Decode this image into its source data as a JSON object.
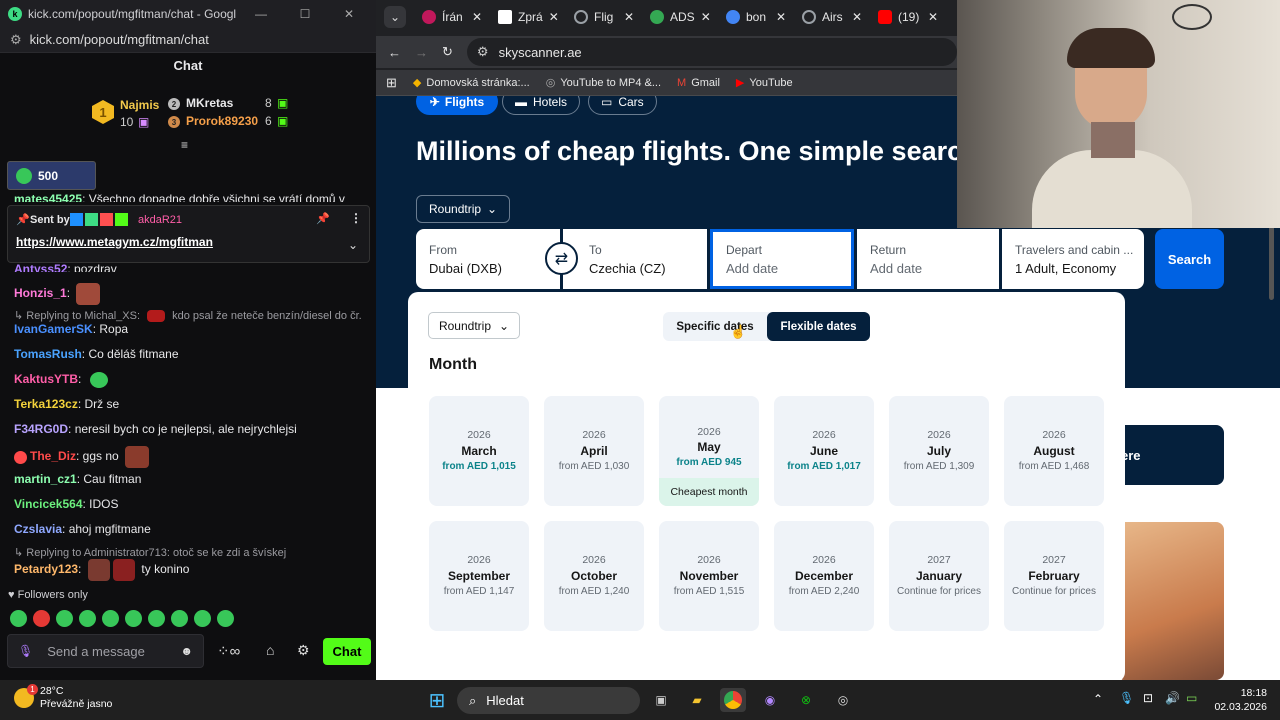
{
  "chat_window": {
    "title": "kick.com/popout/mgfitman/chat - Google Chrome",
    "url": "kick.com/popout/mgfitman/chat",
    "header": "Chat",
    "leaderboard": [
      {
        "name": "Najmis",
        "count": "10",
        "rank": "1"
      },
      {
        "name": "MKretas",
        "count": "8",
        "rank": "2"
      },
      {
        "name": "Prorok89230",
        "count": "6",
        "rank": "3"
      }
    ],
    "points_value": "500",
    "truncated_message": {
      "user": "mates45425",
      "text": ": Všechno dopadne dobře všichni se vrátí domů v"
    },
    "pinned": {
      "sent_by_label": "Sent by",
      "sender": "akdaR21",
      "link": "https://www.metagym.cz/mgfitman"
    },
    "messages": [
      {
        "user": "Antyss52",
        "text": ": pozdrav",
        "color": "#b07cff"
      },
      {
        "user": "Honzis_1",
        "text": ":",
        "color": "#ff7ad9"
      },
      {
        "user": "IvanGamerSK",
        "text": ": Ropa",
        "color": "#4a90ff"
      },
      {
        "user": "TomasRush",
        "text": ": Co děláš fitmane",
        "color": "#4aa3ff"
      },
      {
        "user": "KaktusYTB",
        "text": ":",
        "color": "#ff5ea8"
      },
      {
        "user": "Terka123cz",
        "text": ": Drž se",
        "color": "#f3d23b"
      },
      {
        "user": "F34RG0D",
        "text": ": neresil bych co je nejlepsi, ale nejrychlejsi",
        "color": "#b9a4ff"
      },
      {
        "user": "The_Diz",
        "text": ": ggs no",
        "color": "#ff4a4a"
      },
      {
        "user": "martin_cz1",
        "text": ": Cau fitman",
        "color": "#8dffb0"
      },
      {
        "user": "Vincicek564",
        "text": ": IDOS",
        "color": "#6cf07e"
      },
      {
        "user": "Czslavia",
        "text": ": ahoj mgfitmane",
        "color": "#8fa8ff"
      },
      {
        "user": "Petardy123",
        "text": ":",
        "color": "#ffb86b"
      }
    ],
    "reply1": {
      "label": "Replying to Michal_XS:",
      "text": "kdo psal že neteče benzín/diesel do čr."
    },
    "reply2": {
      "label": "Replying to Administrator713:",
      "text": "otoč se ke zdi a švískej"
    },
    "petardy_tail": "ty konino",
    "followers_only": "Followers only",
    "input_placeholder": "Send a message",
    "chat_button": "Chat"
  },
  "browser": {
    "tabs": [
      {
        "label": "Írán",
        "color": "#c1185b"
      },
      {
        "label": "Zprá",
        "color": "#ffffff"
      },
      {
        "label": "Flig",
        "color": "#9aa0a6"
      },
      {
        "label": "ADS",
        "color": "#34a853"
      },
      {
        "label": "bon",
        "color": "#4285f4"
      },
      {
        "label": "Airs",
        "color": "#9aa0a6"
      },
      {
        "label": "(19)",
        "color": "#ff0000"
      }
    ],
    "address": "skyscanner.ae",
    "bookmarks": [
      "Domovská stránka:...",
      "YouTube to MP4 &...",
      "Gmail",
      "YouTube"
    ]
  },
  "skyscanner": {
    "nav": [
      "Flights",
      "Hotels",
      "Cars"
    ],
    "headline": "Millions of cheap flights. One simple search.",
    "trip_type": "Roundtrip",
    "from": {
      "label": "From",
      "value": "Dubai (DXB)"
    },
    "to": {
      "label": "To",
      "value": "Czechia (CZ)"
    },
    "depart": {
      "label": "Depart",
      "placeholder": "Add date"
    },
    "return": {
      "label": "Return",
      "placeholder": "Add date"
    },
    "travelers": {
      "label": "Travelers and cabin ...",
      "value": "1 Adult, Economy"
    },
    "search_button": "Search",
    "right_button_partial": "ere",
    "panel": {
      "trip_type": "Roundtrip",
      "toggle_specific": "Specific dates",
      "toggle_flexible": "Flexible dates",
      "section_title": "Month",
      "months": [
        {
          "year": "2026",
          "month": "March",
          "price": "from AED 1,015",
          "highlight": true
        },
        {
          "year": "2026",
          "month": "April",
          "price": "from AED 1,030",
          "highlight": false
        },
        {
          "year": "2026",
          "month": "May",
          "price": "from AED 945",
          "highlight": true,
          "badge": "Cheapest month"
        },
        {
          "year": "2026",
          "month": "June",
          "price": "from AED 1,017",
          "highlight": true
        },
        {
          "year": "2026",
          "month": "July",
          "price": "from AED 1,309",
          "highlight": false
        },
        {
          "year": "2026",
          "month": "August",
          "price": "from AED 1,468",
          "highlight": false
        },
        {
          "year": "2026",
          "month": "September",
          "price": "from AED 1,147",
          "highlight": false
        },
        {
          "year": "2026",
          "month": "October",
          "price": "from AED 1,240",
          "highlight": false
        },
        {
          "year": "2026",
          "month": "November",
          "price": "from AED 1,515",
          "highlight": false
        },
        {
          "year": "2026",
          "month": "December",
          "price": "from AED 2,240",
          "highlight": false
        },
        {
          "year": "2027",
          "month": "January",
          "price": "Continue for prices",
          "highlight": false
        },
        {
          "year": "2027",
          "month": "February",
          "price": "Continue for prices",
          "highlight": false
        }
      ]
    }
  },
  "taskbar": {
    "weather_temp": "28°C",
    "weather_desc": "Převážně jasno",
    "weather_badge": "1",
    "search_placeholder": "Hledat",
    "time": "18:18",
    "date": "02.03.2026"
  }
}
